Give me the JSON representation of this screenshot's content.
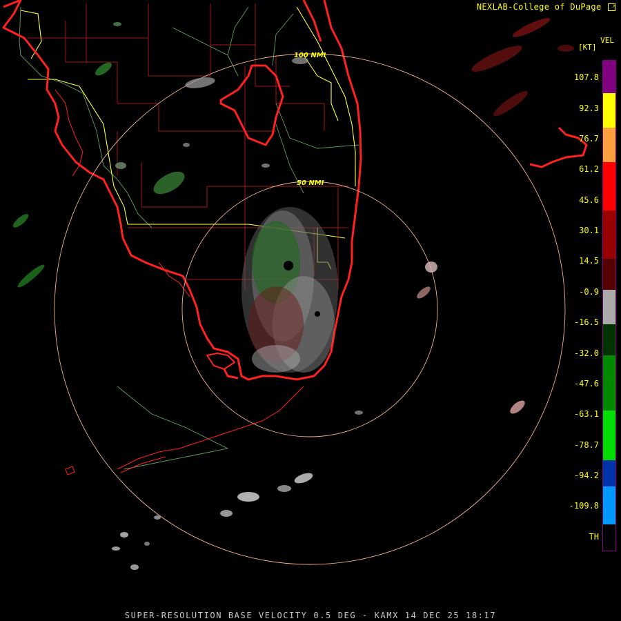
{
  "credit": "NEXLAB-College of DuPage",
  "credit_icon": "external-link-icon",
  "product_label": "VEL",
  "units_label": "[KT]",
  "ring_labels": [
    "100 NMI",
    "50 NMI"
  ],
  "scale_labels": [
    "107.8",
    "92.3",
    "76.7",
    "61.2",
    "45.6",
    "30.1",
    "14.5",
    "-0.9",
    "-16.5",
    "-32.0",
    "-47.6",
    "-63.1",
    "-78.7",
    "-94.2",
    "-109.8",
    "TH"
  ],
  "footer": "SUPER-RESOLUTION BASE VELOCITY 0.5 DEG - KAMX 14 DEC 25 18:17",
  "colors": {
    "coastline": "#ff2020",
    "county_lines": "#a01818",
    "highways": "#ffff40",
    "rivers": "#5fa05f",
    "range_rings": "#f0b08c",
    "label_text": "#ffff00",
    "colorbar": [
      "#800080",
      "#ffff00",
      "#ff0000",
      "#660000",
      "#999999",
      "#006600",
      "#00dd00",
      "#0055cc",
      "#0099ff",
      "#000000"
    ]
  }
}
